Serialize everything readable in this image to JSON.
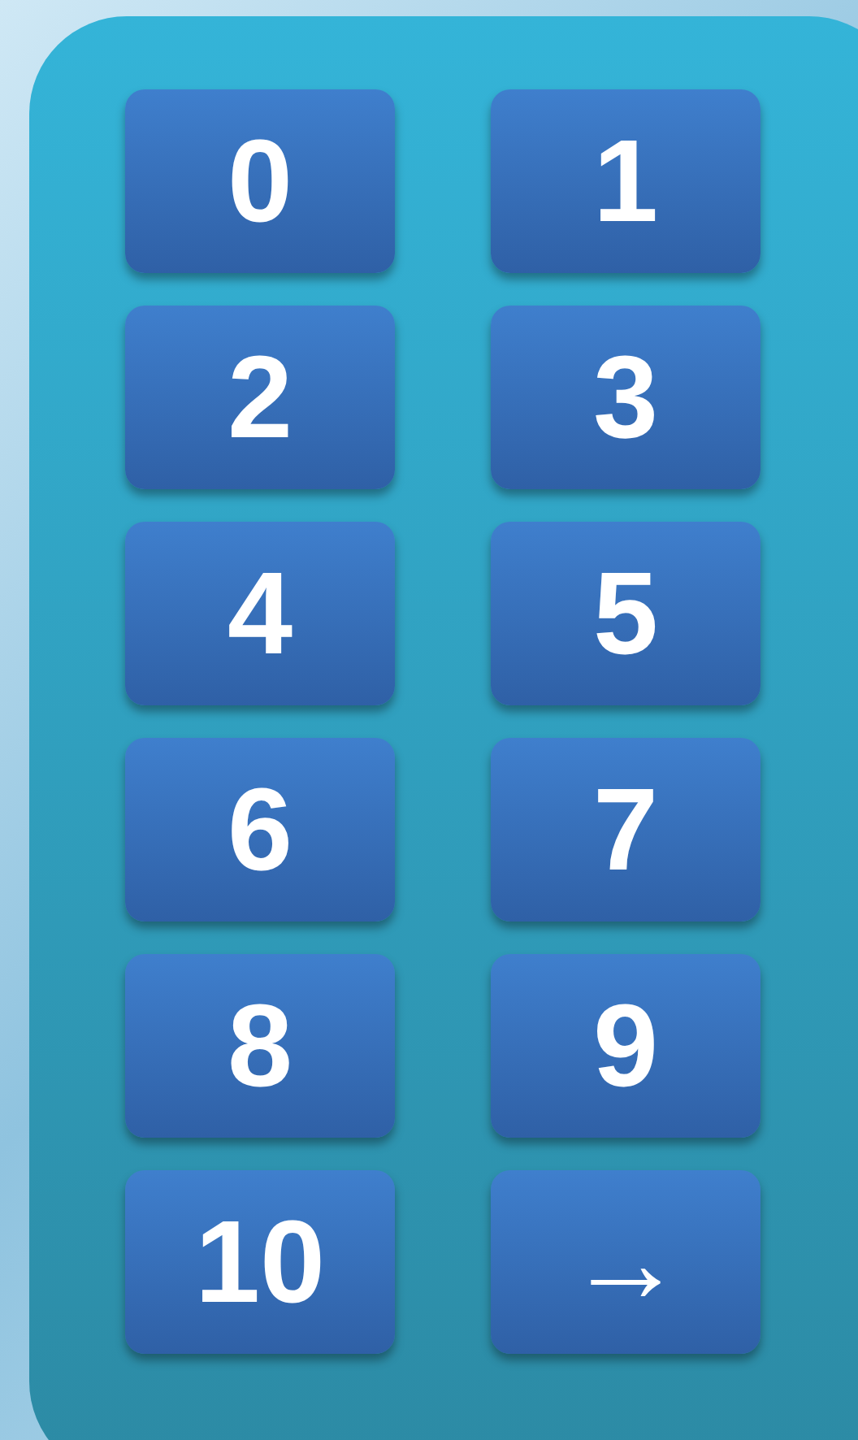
{
  "keys": [
    {
      "label": "0"
    },
    {
      "label": "1"
    },
    {
      "label": "2"
    },
    {
      "label": "3"
    },
    {
      "label": "4"
    },
    {
      "label": "5"
    },
    {
      "label": "6"
    },
    {
      "label": "7"
    },
    {
      "label": "8"
    },
    {
      "label": "9"
    },
    {
      "label": "10"
    },
    {
      "label": "→"
    }
  ]
}
